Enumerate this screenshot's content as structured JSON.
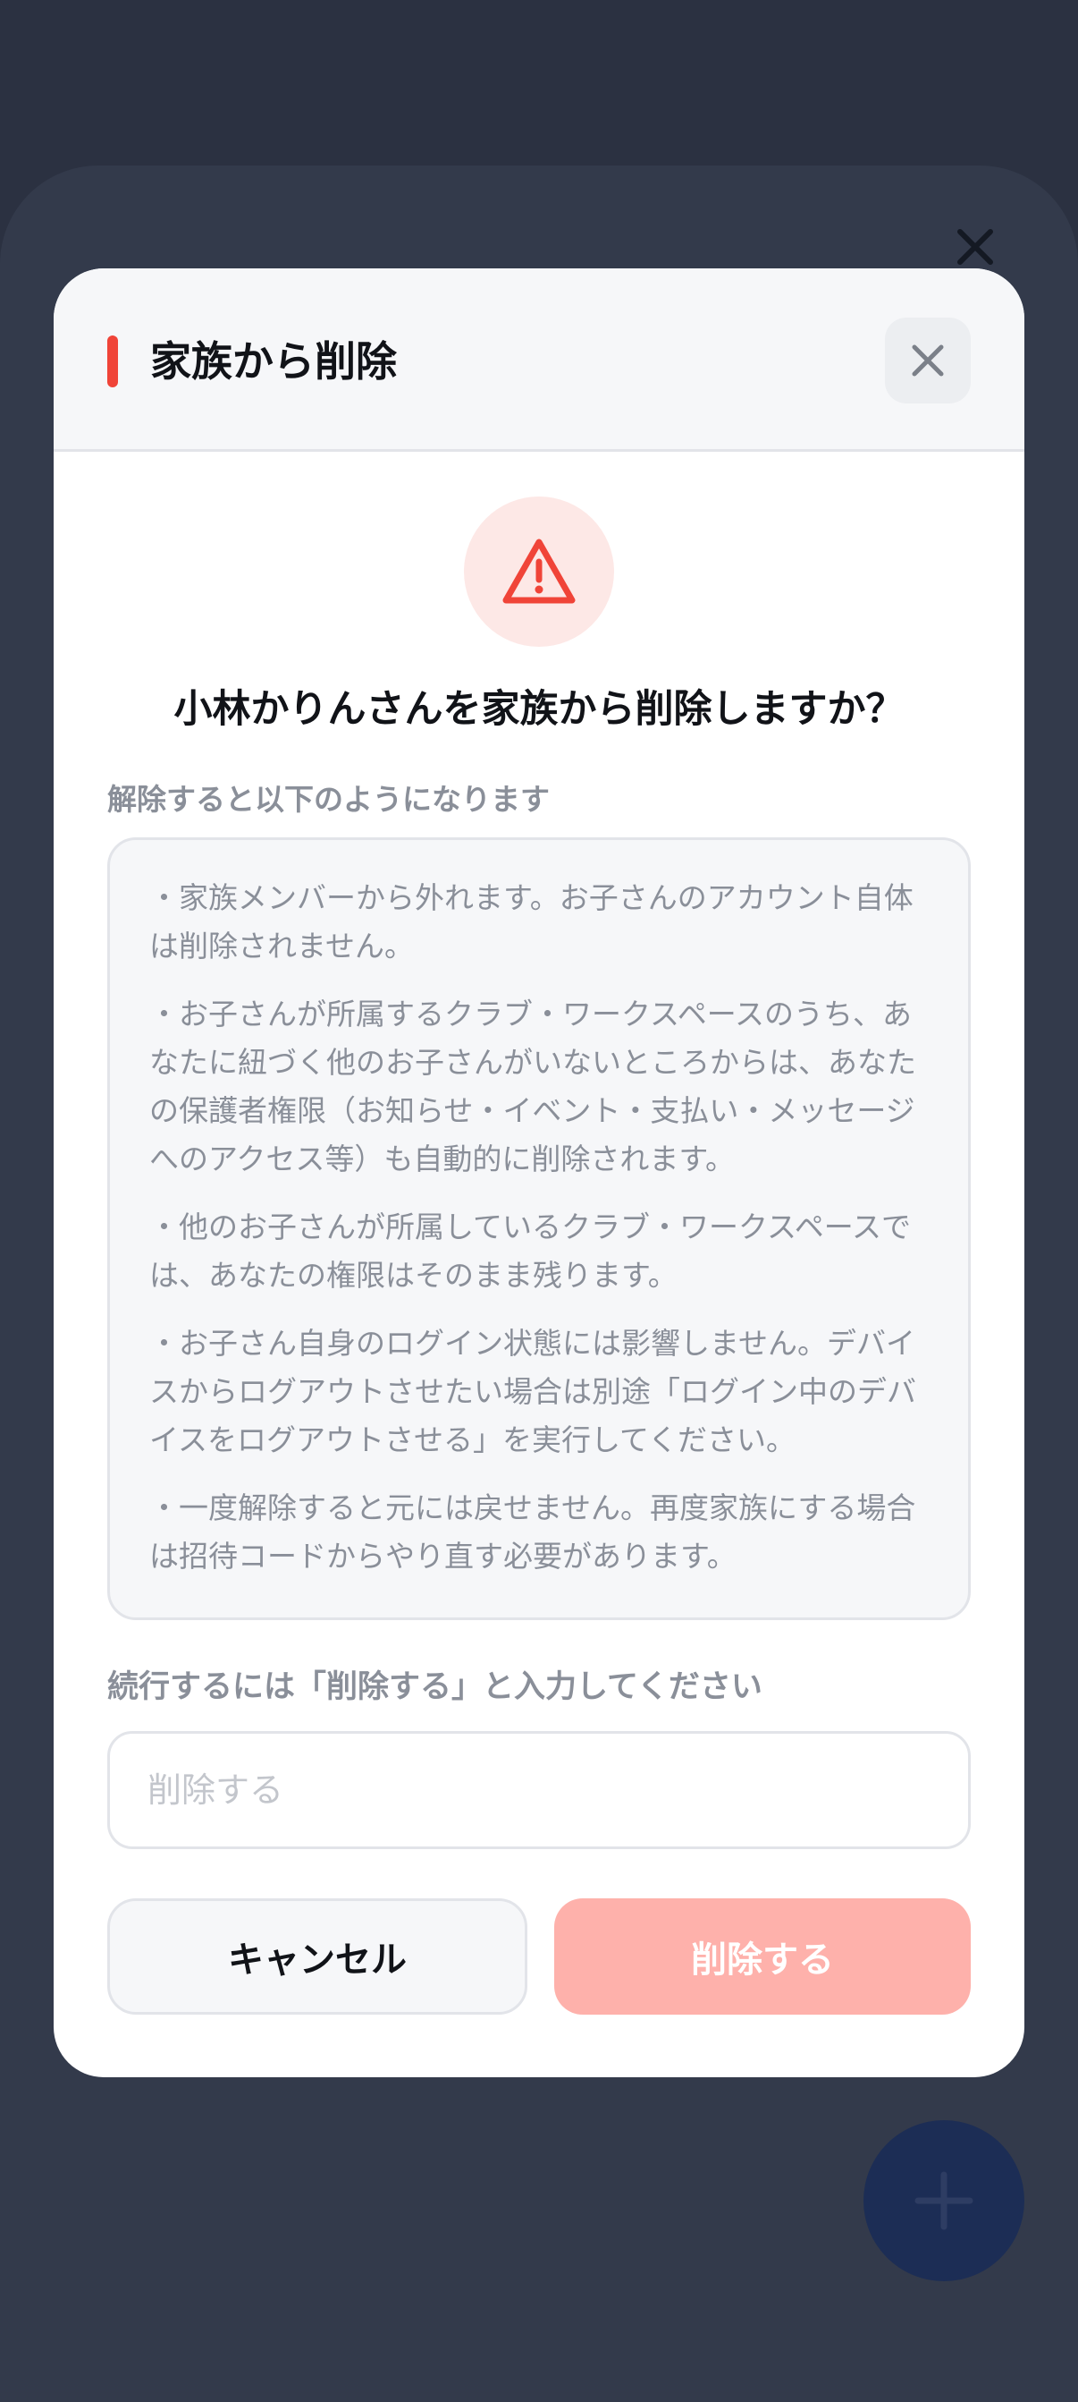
{
  "colors": {
    "accent": "#f04438",
    "danger_disabled": "#feb1ab",
    "backdrop": "#2b3141",
    "fab": "#1c2d55"
  },
  "background": {
    "close_icon": "close-icon",
    "fab_icon": "plus-icon"
  },
  "modal": {
    "title": "家族から削除",
    "close_icon": "close-icon",
    "warning_icon": "warning-triangle-icon",
    "question": "小林かりんさんを家族から削除しますか？",
    "section_label": "解除すると以下のようになります",
    "info_items": [
      "・家族メンバーから外れます。お子さんのアカウント自体は削除されません。",
      "・お子さんが所属するクラブ・ワークスペースのうち、あなたに紐づく他のお子さんがいないところからは、あなたの保護者権限（お知らせ・イベント・支払い・メッセージへのアクセス等）も自動的に削除されます。",
      "・他のお子さんが所属しているクラブ・ワークスペースでは、あなたの権限はそのまま残ります。",
      "・お子さん自身のログイン状態には影響しません。デバイスからログアウトさせたい場合は別途「ログイン中のデバイスをログアウトさせる」を実行してください。",
      "・一度解除すると元には戻せません。再度家族にする場合は招待コードからやり直す必要があります。"
    ],
    "confirm_label": "続行するには「削除する」と入力してください",
    "confirm_input": {
      "value": "",
      "placeholder": "削除する"
    },
    "cancel_label": "キャンセル",
    "delete_label": "削除する"
  }
}
